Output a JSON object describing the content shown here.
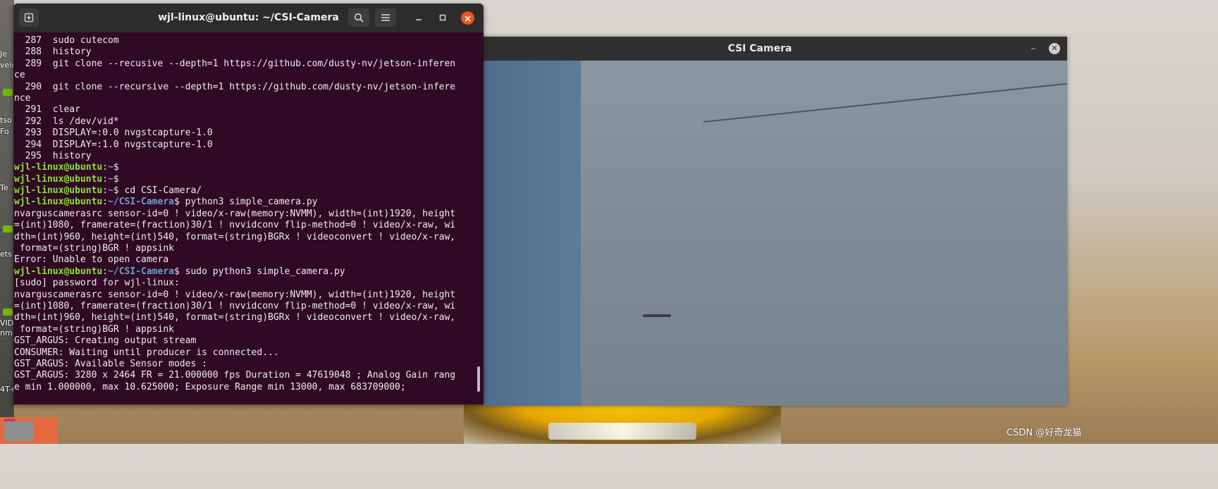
{
  "desktop": {
    "left_labels": [
      "Je",
      "velo",
      "tso",
      "Fo",
      "Te",
      "ets",
      "VID",
      "nm",
      "4T-r"
    ]
  },
  "terminal": {
    "title": "wjl-linux@ubuntu: ~/CSI-Camera",
    "icons": {
      "new_tab": "new-tab-icon",
      "search": "search-icon",
      "menu": "hamburger-menu-icon",
      "minimize": "minimize-icon",
      "maximize": "maximize-icon",
      "close": "close-icon"
    },
    "colors": {
      "background": "#300a24",
      "prompt_user": "#8ae234",
      "prompt_path": "#729fcf",
      "close_button": "#e9541f"
    },
    "lines": [
      {
        "text": "  287  sudo cutecom"
      },
      {
        "text": "  288  history"
      },
      {
        "text": "  289  git clone --recusive --depth=1 https://github.com/dusty-nv/jetson-inferen"
      },
      {
        "text": "ce"
      },
      {
        "text": "  290  git clone --recursive --depth=1 https://github.com/dusty-nv/jetson-infere"
      },
      {
        "text": "nce"
      },
      {
        "text": "  291  clear"
      },
      {
        "text": "  292  ls /dev/vid*"
      },
      {
        "text": "  293  DISPLAY=:0.0 nvgstcapture-1.0"
      },
      {
        "text": "  294  DISPLAY=:1.0 nvgstcapture-1.0"
      },
      {
        "text": "  295  history"
      },
      {
        "user": "wjl-linux@ubuntu",
        "sep": ":",
        "path": "~",
        "cmd": "$"
      },
      {
        "user": "wjl-linux@ubuntu",
        "sep": ":",
        "path": "~",
        "cmd": "$"
      },
      {
        "user": "wjl-linux@ubuntu",
        "sep": ":",
        "path": "~",
        "cmd": "$ cd CSI-Camera/"
      },
      {
        "user": "wjl-linux@ubuntu",
        "sep": ":",
        "path": "~/CSI-Camera",
        "cmd": "$ python3 simple_camera.py"
      },
      {
        "text": "nvarguscamerasrc sensor-id=0 ! video/x-raw(memory:NVMM), width=(int)1920, height"
      },
      {
        "text": "=(int)1080, framerate=(fraction)30/1 ! nvvidconv flip-method=0 ! video/x-raw, wi"
      },
      {
        "text": "dth=(int)960, height=(int)540, format=(string)BGRx ! videoconvert ! video/x-raw,"
      },
      {
        "text": " format=(string)BGR ! appsink"
      },
      {
        "text": "Error: Unable to open camera"
      },
      {
        "user": "wjl-linux@ubuntu",
        "sep": ":",
        "path": "~/CSI-Camera",
        "cmd": "$ sudo python3 simple_camera.py"
      },
      {
        "text": "[sudo] password for wjl-linux:"
      },
      {
        "text": "nvarguscamerasrc sensor-id=0 ! video/x-raw(memory:NVMM), width=(int)1920, height"
      },
      {
        "text": "=(int)1080, framerate=(fraction)30/1 ! nvvidconv flip-method=0 ! video/x-raw, wi"
      },
      {
        "text": "dth=(int)960, height=(int)540, format=(string)BGRx ! videoconvert ! video/x-raw,"
      },
      {
        "text": " format=(string)BGR ! appsink"
      },
      {
        "text": "GST_ARGUS: Creating output stream"
      },
      {
        "text": "CONSUMER: Waiting until producer is connected..."
      },
      {
        "text": "GST_ARGUS: Available Sensor modes :"
      },
      {
        "text": "GST_ARGUS: 3280 x 2464 FR = 21.000000 fps Duration = 47619048 ; Analog Gain rang"
      },
      {
        "text": "e min 1.000000, max 10.625000; Exposure Range min 13000, max 683709000;"
      }
    ]
  },
  "camera_window": {
    "title": "CSI Camera",
    "minimize_glyph": "–",
    "close_glyph": "✕",
    "icons": {
      "minimize": "minimize-icon",
      "close": "close-icon"
    }
  },
  "watermark": "CSDN @好奇龙猫"
}
